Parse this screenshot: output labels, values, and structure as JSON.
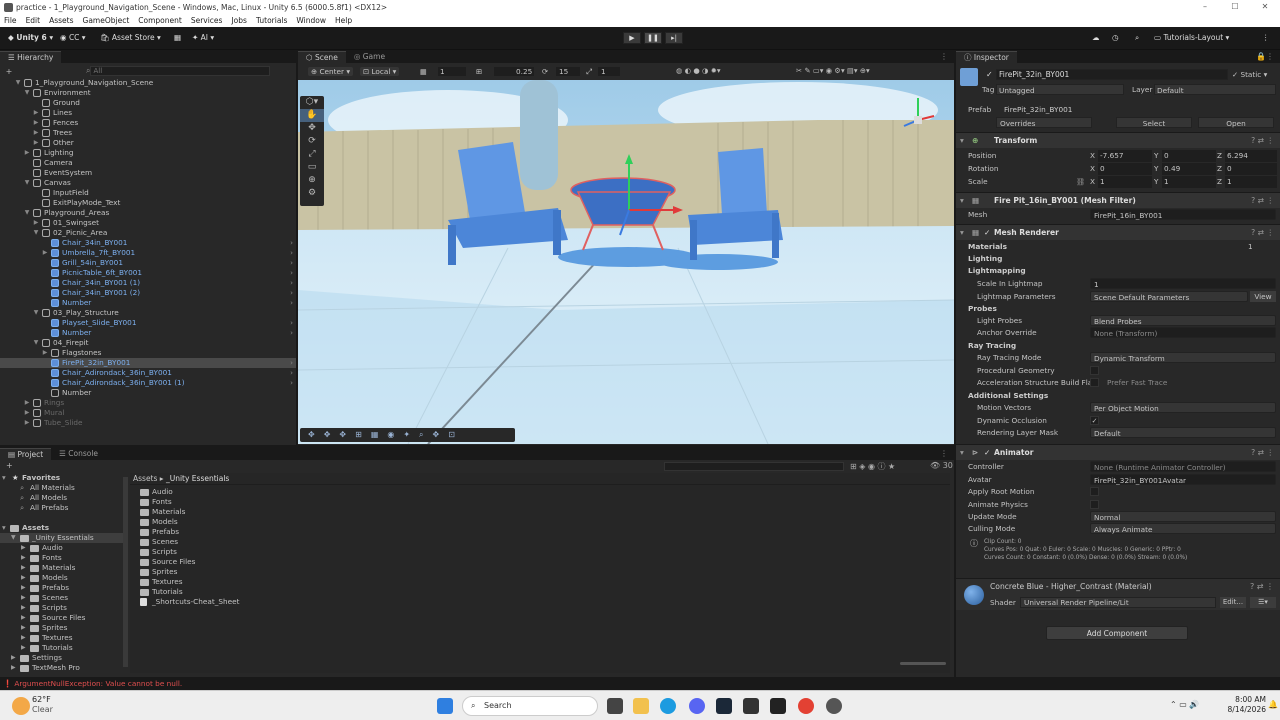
{
  "window": {
    "title": "practice - 1_Playground_Navigation_Scene - Windows, Mac, Linux - Unity 6.5 (6000.5.8f1) <DX12>"
  },
  "menu": [
    "File",
    "Edit",
    "Assets",
    "GameObject",
    "Component",
    "Services",
    "Jobs",
    "Tutorials",
    "Window",
    "Help"
  ],
  "toolbar": {
    "unity_label": "Unity 6",
    "cc_label": "CC",
    "asset_store_label": "Asset Store",
    "ai_label": "AI",
    "layout_label": "Tutorials-Layout"
  },
  "hierarchy": {
    "tab": "Hierarchy",
    "search_placeholder": "All",
    "rows": [
      {
        "label": "1_Playground_Navigation_Scene",
        "kind": "scene"
      },
      {
        "label": "Environment"
      },
      {
        "label": "Ground"
      },
      {
        "label": "Lines"
      },
      {
        "label": "Fences"
      },
      {
        "label": "Trees"
      },
      {
        "label": "Other"
      },
      {
        "label": "Lighting"
      },
      {
        "label": "Camera"
      },
      {
        "label": "EventSystem"
      },
      {
        "label": "Canvas"
      },
      {
        "label": "InputField"
      },
      {
        "label": "ExitPlayMode_Text"
      },
      {
        "label": "Playground_Areas"
      },
      {
        "label": "01_Swingset"
      },
      {
        "label": "02_Picnic_Area"
      },
      {
        "label": "Chair_34in_BY001",
        "kind": "prefab"
      },
      {
        "label": "Umbrella_7ft_BY001",
        "kind": "prefab"
      },
      {
        "label": "Grill_54in_BY001",
        "kind": "prefab"
      },
      {
        "label": "PicnicTable_6ft_BY001",
        "kind": "prefab"
      },
      {
        "label": "Chair_34in_BY001 (1)",
        "kind": "prefab"
      },
      {
        "label": "Chair_34in_BY001 (2)",
        "kind": "prefab"
      },
      {
        "label": "Number",
        "kind": "prefab"
      },
      {
        "label": "03_Play_Structure"
      },
      {
        "label": "Playset_Slide_BY001",
        "kind": "prefab"
      },
      {
        "label": "Number",
        "kind": "prefab"
      },
      {
        "label": "04_Firepit"
      },
      {
        "label": "Flagstones"
      },
      {
        "label": "FirePit_32in_BY001",
        "kind": "prefab",
        "selected": true
      },
      {
        "label": "Chair_Adirondack_36in_BY001",
        "kind": "prefab"
      },
      {
        "label": "Chair_Adirondack_36in_BY001 (1)",
        "kind": "prefab"
      },
      {
        "label": "Number"
      },
      {
        "label": "Rings",
        "kind": "dim"
      },
      {
        "label": "Mural",
        "kind": "dim"
      },
      {
        "label": "Tube_Slide",
        "kind": "dim"
      }
    ]
  },
  "scene": {
    "tab_scene": "Scene",
    "tab_game": "Game",
    "pivot": "Center",
    "space": "Local",
    "grid_value": "1",
    "snap_value": "0.25",
    "rotate_snap": "15",
    "scale_snap": "1"
  },
  "inspector": {
    "tab": "Inspector",
    "object_name": "FirePit_32in_BY001",
    "static_label": "Static",
    "tag_label": "Tag",
    "tag_value": "Untagged",
    "layer_label": "Layer",
    "layer_value": "Default",
    "prefab_label": "Prefab",
    "prefab_value": "FirePit_32in_BY001",
    "overrides_label": "Overrides",
    "select_label": "Select",
    "open_label": "Open",
    "transform": {
      "title": "Transform",
      "position_label": "Position",
      "position": {
        "x": "-7.657",
        "y": "0",
        "z": "6.294"
      },
      "rotation_label": "Rotation",
      "rotation": {
        "x": "0",
        "y": "0.49",
        "z": "0"
      },
      "scale_label": "Scale",
      "scale": {
        "x": "1",
        "y": "1",
        "z": "1"
      }
    },
    "mesh_filter": {
      "title": "Fire Pit_16in_BY001 (Mesh Filter)",
      "mesh_label": "Mesh",
      "mesh_value": "FirePit_16in_BY001"
    },
    "mesh_renderer": {
      "title": "Mesh Renderer",
      "materials_label": "Materials",
      "materials_count": "1",
      "lighting_label": "Lighting",
      "lightmapping_label": "Lightmapping",
      "scale_lightmap_label": "Scale In Lightmap",
      "scale_lightmap_value": "1",
      "lightmap_params_label": "Lightmap Parameters",
      "lightmap_params_value": "Scene Default Parameters",
      "view_label": "View",
      "probes_label": "Probes",
      "light_probes_label": "Light Probes",
      "light_probes_value": "Blend Probes",
      "anchor_override_label": "Anchor Override",
      "anchor_override_value": "None (Transform)",
      "ray_tracing_label": "Ray Tracing",
      "ray_tracing_mode_label": "Ray Tracing Mode",
      "ray_tracing_mode_value": "Dynamic Transform",
      "procedural_geometry_label": "Procedural Geometry",
      "accel_label": "Acceleration Structure Build Fla",
      "accel_value": "Prefer Fast Trace",
      "additional_label": "Additional Settings",
      "motion_vectors_label": "Motion Vectors",
      "motion_vectors_value": "Per Object Motion",
      "dynamic_occlusion_label": "Dynamic Occlusion",
      "rendering_layer_label": "Rendering Layer Mask",
      "rendering_layer_value": "Default"
    },
    "animator": {
      "title": "Animator",
      "controller_label": "Controller",
      "controller_value": "None (Runtime Animator Controller)",
      "avatar_label": "Avatar",
      "avatar_value": "FirePit_32in_BY001Avatar",
      "apply_root_label": "Apply Root Motion",
      "animate_physics_label": "Animate Physics",
      "update_mode_label": "Update Mode",
      "update_mode_value": "Normal",
      "culling_mode_label": "Culling Mode",
      "culling_mode_value": "Always Animate",
      "info_line1": "Clip Count: 0",
      "info_line2": "Curves Pos: 0 Quat: 0 Euler: 0 Scale: 0 Muscles: 0 Generic: 0 PPtr: 0",
      "info_line3": "Curves Count: 0 Constant: 0 (0.0%) Dense: 0 (0.0%) Stream: 0 (0.0%)"
    },
    "material": {
      "title": "Concrete Blue - Higher_Contrast (Material)",
      "shader_label": "Shader",
      "shader_value": "Universal Render Pipeline/Lit",
      "edit_label": "Edit..."
    },
    "add_component_label": "Add Component"
  },
  "project": {
    "tab_project": "Project",
    "tab_console": "Console",
    "favorites_label": "Favorites",
    "favorites": [
      "All Materials",
      "All Models",
      "All Prefabs"
    ],
    "assets_label": "Assets",
    "tree": [
      "_Unity Essentials",
      "Audio",
      "Fonts",
      "Materials",
      "Models",
      "Prefabs",
      "Scenes",
      "Scripts",
      "Source Files",
      "Sprites",
      "Textures",
      "Tutorials",
      "Settings",
      "TextMesh Pro"
    ],
    "breadcrumb_root": "Assets",
    "breadcrumb_leaf": "_Unity Essentials",
    "items": [
      "Audio",
      "Fonts",
      "Materials",
      "Models",
      "Prefabs",
      "Scenes",
      "Scripts",
      "Source Files",
      "Sprites",
      "Textures",
      "Tutorials",
      "_Shortcuts-Cheat_Sheet"
    ],
    "hidden_count": "30"
  },
  "status": {
    "error": "ArgumentNullException: Value cannot be null."
  },
  "taskbar": {
    "weather_temp": "62°F",
    "weather_desc": "Clear",
    "search_label": "Search",
    "time": "8:00 AM",
    "date": "8/14/2026"
  },
  "colors": {
    "prefab_blue": "#7cafee",
    "selection": "#4a4a4a",
    "error_red": "#e04f4f"
  }
}
